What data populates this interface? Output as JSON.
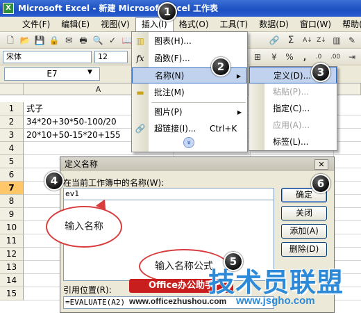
{
  "window": {
    "app_icon": "excel-icon",
    "title": "Microsoft Excel - 新建 Microsoft Excel 工作表"
  },
  "menubar": {
    "items": [
      "文件(F)",
      "编辑(E)",
      "视图(V)",
      "插入(I)",
      "格式(O)",
      "工具(T)",
      "数据(D)",
      "窗口(W)",
      "帮助(H)"
    ],
    "active_index": 3
  },
  "toolbar": {
    "font_name": "宋体",
    "font_size": "12",
    "extra_glyphs": [
      "%",
      ","
    ]
  },
  "formula_bar": {
    "name_box": "E7",
    "name_box_arrow": "▼"
  },
  "sheet": {
    "column_a": "A",
    "selected_row": 7,
    "rows": [
      "1",
      "2",
      "3",
      "4",
      "5",
      "6",
      "7",
      "8",
      "9",
      "10",
      "11",
      "12",
      "13",
      "14",
      "15"
    ],
    "cells": [
      "式子",
      "34*20+30*50-100/20",
      "20*10+50-15*20+155"
    ]
  },
  "insert_menu": {
    "items": [
      {
        "icon": "chart-icon",
        "label": "图表(H)..."
      },
      {
        "icon": "function-icon",
        "label": "函数(F)..."
      },
      {
        "icon": "",
        "label": "名称(N)",
        "has_submenu": true
      },
      {
        "icon": "comment-icon",
        "label": "批注(M)"
      },
      {
        "icon": "",
        "label": "图片(P)",
        "has_submenu": true
      },
      {
        "icon": "hyperlink-icon",
        "label": "超链接(I)...",
        "shortcut": "Ctrl+K"
      }
    ],
    "expand_glyph": "»"
  },
  "name_submenu": {
    "items": [
      {
        "label": "定义(D)...",
        "enabled": true
      },
      {
        "label": "粘贴(P)...",
        "enabled": false
      },
      {
        "label": "指定(C)...",
        "enabled": true
      },
      {
        "label": "应用(A)...",
        "enabled": false
      },
      {
        "label": "标签(L)...",
        "enabled": true
      }
    ]
  },
  "dialog": {
    "title": "定义名称",
    "close_glyph": "✕",
    "names_label": "在当前工作簿中的名称(W):",
    "name_value": "ev1",
    "ref_label": "引用位置(R):",
    "ref_value": "=EVALUATE(A2)",
    "buttons": [
      "确定",
      "关闭",
      "添加(A)",
      "删除(D)"
    ]
  },
  "annotations": {
    "steps": [
      "1",
      "2",
      "3",
      "4",
      "5",
      "6"
    ],
    "bubble_name": "输入名称",
    "bubble_formula": "输入名称公式"
  },
  "watermark": {
    "logo_text": "Office办公助手",
    "url1": "www.officezhushou.com",
    "brand": "技术员联盟",
    "url2": "www.jsgho.com"
  }
}
